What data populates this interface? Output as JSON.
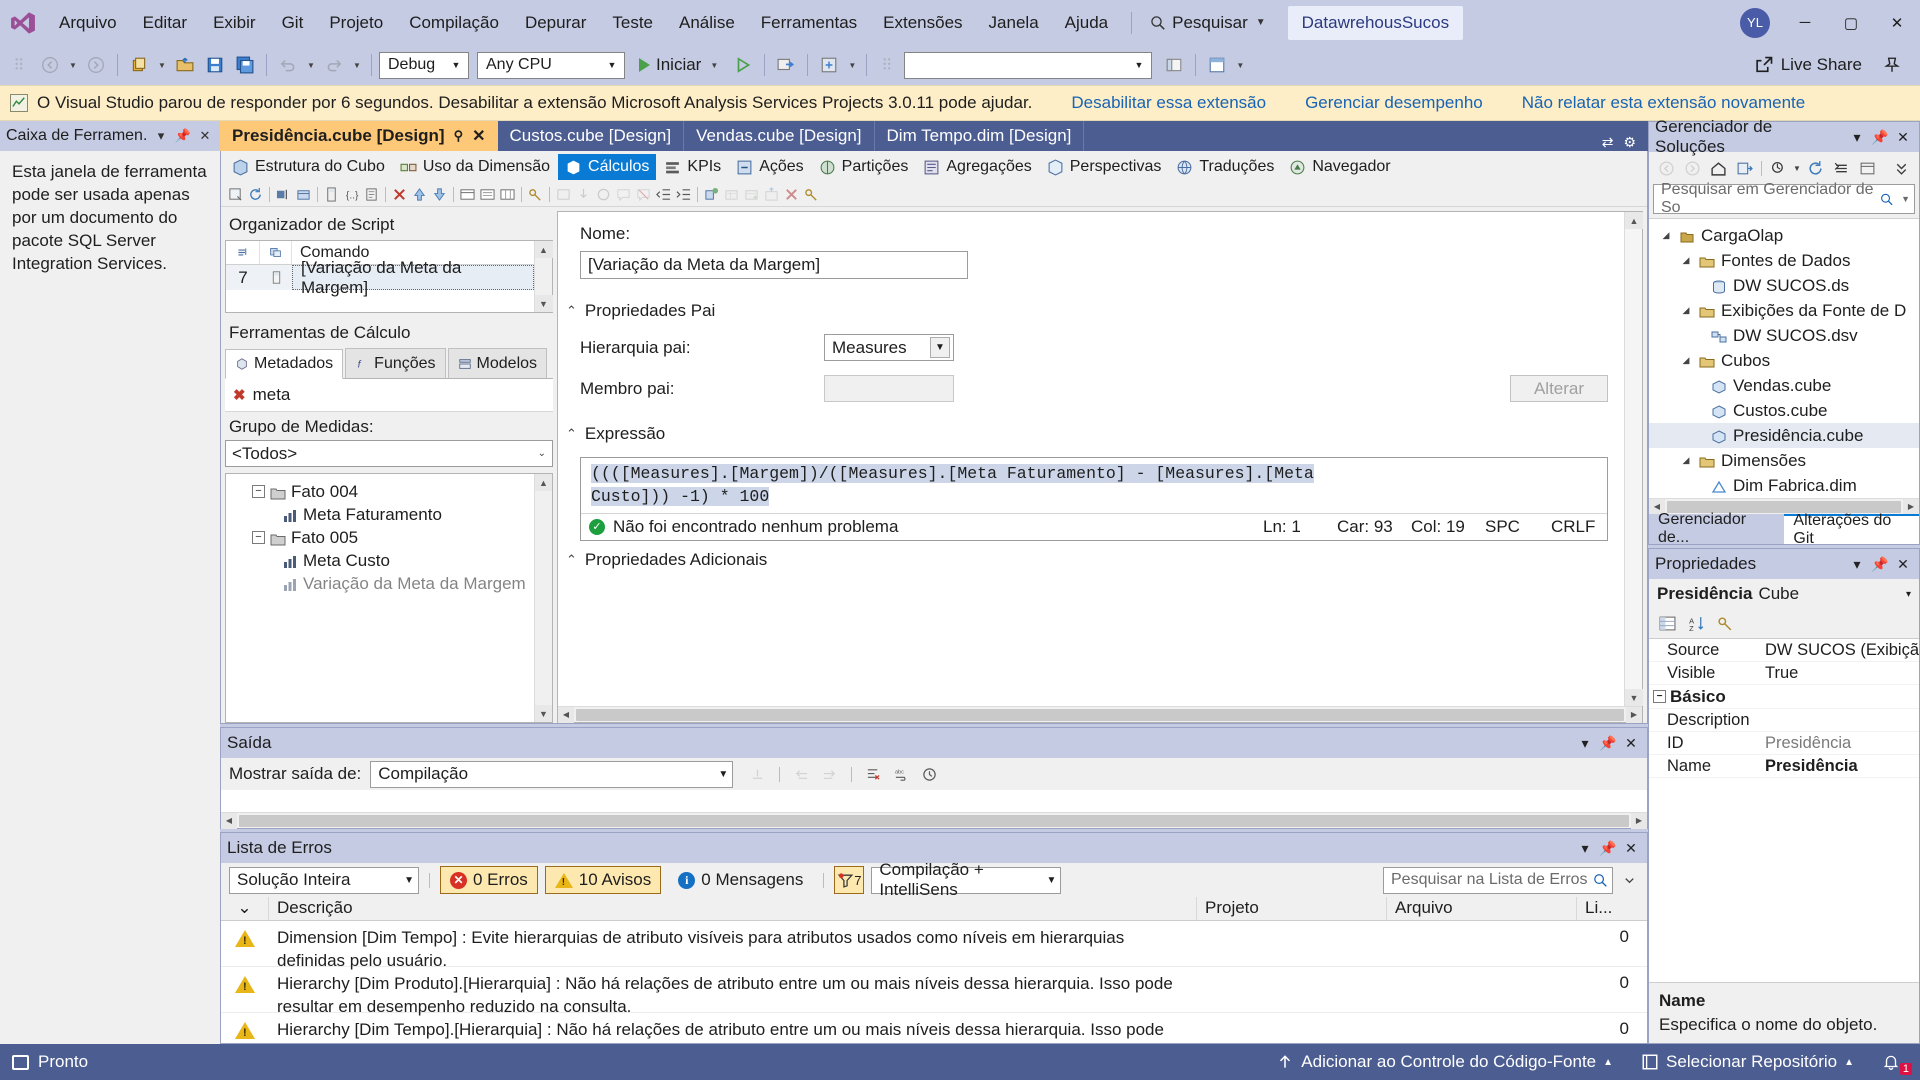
{
  "titlebar": {
    "menus": [
      "Arquivo",
      "Editar",
      "Exibir",
      "Git",
      "Projeto",
      "Compilação",
      "Depurar",
      "Teste",
      "Análise",
      "Ferramentas",
      "Extensões",
      "Janela",
      "Ajuda"
    ],
    "search_label": "Pesquisar",
    "project_chip": "DatawrehousSucos",
    "avatar_initials": "YL",
    "minimize": "─",
    "maximize": "▢",
    "close": "✕"
  },
  "toolbar": {
    "config": "Debug",
    "platform": "Any CPU",
    "start_label": "Iniciar",
    "live_share": "Live Share"
  },
  "notification": {
    "message": "O Visual Studio parou de responder por 6 segundos. Desabilitar a extensão Microsoft Analysis Services Projects 3.0.11 pode ajudar.",
    "links": [
      "Desabilitar essa extensão",
      "Gerenciar desempenho",
      "Não relatar esta extensão novamente"
    ]
  },
  "toolbox": {
    "title": "Caixa de Ferramen...",
    "message": "Esta janela de ferramenta pode ser usada apenas por um documento do pacote SQL Server Integration Services."
  },
  "doc_tabs": [
    {
      "label": "Presidência.cube [Design]",
      "active": true
    },
    {
      "label": "Custos.cube [Design]",
      "active": false
    },
    {
      "label": "Vendas.cube [Design]",
      "active": false
    },
    {
      "label": "Dim Tempo.dim [Design]",
      "active": false
    }
  ],
  "cube_tabs": [
    {
      "label": "Estrutura do Cubo",
      "selected": false
    },
    {
      "label": "Uso da Dimensão",
      "selected": false
    },
    {
      "label": "Cálculos",
      "selected": true
    },
    {
      "label": "KPIs",
      "selected": false
    },
    {
      "label": "Ações",
      "selected": false
    },
    {
      "label": "Partições",
      "selected": false
    },
    {
      "label": "Agregações",
      "selected": false
    },
    {
      "label": "Perspectivas",
      "selected": false
    },
    {
      "label": "Traduções",
      "selected": false
    },
    {
      "label": "Navegador",
      "selected": false
    }
  ],
  "script_organizer": {
    "title": "Organizador de Script",
    "col_command": "Comando",
    "rows": [
      {
        "num": "7",
        "command": "[Variação da Meta da Margem]"
      }
    ]
  },
  "calc_tools": {
    "title": "Ferramentas de Cálculo",
    "tabs": [
      {
        "label": "Metadados",
        "selected": true
      },
      {
        "label": "Funções",
        "selected": false
      },
      {
        "label": "Modelos",
        "selected": false
      }
    ],
    "meta_item": "meta",
    "measure_group_label": "Grupo de Medidas:",
    "measure_group_value": "<Todos>",
    "tree": [
      {
        "label": "Fato 004",
        "level": 1,
        "type": "folder"
      },
      {
        "label": "Meta Faturamento",
        "level": 2,
        "type": "measure"
      },
      {
        "label": "Fato 005",
        "level": 1,
        "type": "folder"
      },
      {
        "label": "Meta Custo",
        "level": 2,
        "type": "measure"
      },
      {
        "label": "Variação da Meta da Margem",
        "level": 2,
        "type": "measure"
      }
    ]
  },
  "calc_editor": {
    "name_label": "Nome:",
    "name_value": "[Variação da Meta da Margem]",
    "parent_props_header": "Propriedades Pai",
    "parent_hierarchy_label": "Hierarquia pai:",
    "parent_hierarchy_value": "Measures",
    "parent_member_label": "Membro pai:",
    "parent_member_value": "",
    "change_button": "Alterar",
    "expression_header": "Expressão",
    "expression_line1": "((([Measures].[Margem])/([Measures].[Meta Faturamento] - [Measures].[Meta",
    "expression_line2": "Custo])) -1) * 100",
    "status_message": "Não foi encontrado nenhum problema",
    "status_ln": "Ln: 1",
    "status_car": "Car: 93",
    "status_col": "Col: 19",
    "status_spc": "SPC",
    "status_crlf": "CRLF",
    "additional_props_header": "Propriedades Adicionais"
  },
  "output": {
    "title": "Saída",
    "show_label": "Mostrar saída de:",
    "show_value": "Compilação"
  },
  "error_list": {
    "title": "Lista de Erros",
    "scope": "Solução Inteira",
    "errors_count": "0 Erros",
    "warnings_count": "10 Avisos",
    "messages_count": "0 Mensagens",
    "filter_badge": "7",
    "build_filter": "Compilação + IntelliSens",
    "search_placeholder": "Pesquisar na Lista de Erros",
    "columns": [
      "",
      "",
      "Descrição",
      "Projeto",
      "Arquivo",
      "Li..."
    ],
    "rows": [
      {
        "severity": "warning",
        "description": "Dimension [Dim Tempo] : Evite hierarquias de atributo visíveis para atributos usados como níveis em hierarquias definidas pelo usuário.",
        "project": "",
        "file": "",
        "line": "0"
      },
      {
        "severity": "warning",
        "description": "Hierarchy [Dim Produto].[Hierarquia] : Não há relações de atributo entre um ou mais níveis dessa hierarquia. Isso pode resultar em desempenho reduzido na consulta.",
        "project": "",
        "file": "",
        "line": "0"
      },
      {
        "severity": "warning",
        "description": "Hierarchy [Dim Tempo].[Hierarquia] : Não há relações de atributo entre um ou mais níveis dessa hierarquia. Isso pode resultar em desempenho reduzido na consulta.",
        "project": "",
        "file": "",
        "line": "0"
      }
    ]
  },
  "solution_explorer": {
    "title": "Gerenciador de Soluções",
    "search_placeholder": "Pesquisar em Gerenciador de So",
    "tree": [
      {
        "label": "CargaOlap",
        "level": 0,
        "icon": "solution",
        "expanded": true,
        "selected": false
      },
      {
        "label": "Fontes de Dados",
        "level": 1,
        "icon": "folder",
        "expanded": true,
        "selected": false
      },
      {
        "label": "DW SUCOS.ds",
        "level": 2,
        "icon": "datasource",
        "expanded": null,
        "selected": false
      },
      {
        "label": "Exibições da Fonte de D",
        "level": 1,
        "icon": "folder",
        "expanded": true,
        "selected": false
      },
      {
        "label": "DW SUCOS.dsv",
        "level": 2,
        "icon": "dsv",
        "expanded": null,
        "selected": false
      },
      {
        "label": "Cubos",
        "level": 1,
        "icon": "folder",
        "expanded": true,
        "selected": false
      },
      {
        "label": "Vendas.cube",
        "level": 2,
        "icon": "cube",
        "expanded": null,
        "selected": false
      },
      {
        "label": "Custos.cube",
        "level": 2,
        "icon": "cube",
        "expanded": null,
        "selected": false
      },
      {
        "label": "Presidência.cube",
        "level": 2,
        "icon": "cube",
        "expanded": null,
        "selected": true
      },
      {
        "label": "Dimensões",
        "level": 1,
        "icon": "folder",
        "expanded": true,
        "selected": false
      },
      {
        "label": "Dim Fabrica.dim",
        "level": 2,
        "icon": "dim",
        "expanded": null,
        "selected": false
      }
    ],
    "tabs": [
      {
        "label": "Gerenciador de...",
        "selected": false
      },
      {
        "label": "Alterações do Git",
        "selected": true
      }
    ]
  },
  "properties": {
    "title": "Propriedades",
    "object_name": "Presidência",
    "object_type": "Cube",
    "rows": [
      {
        "key": "Source",
        "value": "DW SUCOS (Exibiçã",
        "style": "normal"
      },
      {
        "key": "Visible",
        "value": "True",
        "style": "normal"
      }
    ],
    "category": "Básico",
    "cat_rows": [
      {
        "key": "Description",
        "value": "",
        "style": "normal"
      },
      {
        "key": "ID",
        "value": "Presidência",
        "style": "gray"
      },
      {
        "key": "Name",
        "value": "Presidência",
        "style": "bold"
      }
    ],
    "desc_title": "Name",
    "desc_text": "Especifica o nome do objeto."
  },
  "statusbar": {
    "ready": "Pronto",
    "source_control": "Adicionar ao Controle do Código-Fonte",
    "repo": "Selecionar Repositório",
    "notif_count": "1"
  }
}
